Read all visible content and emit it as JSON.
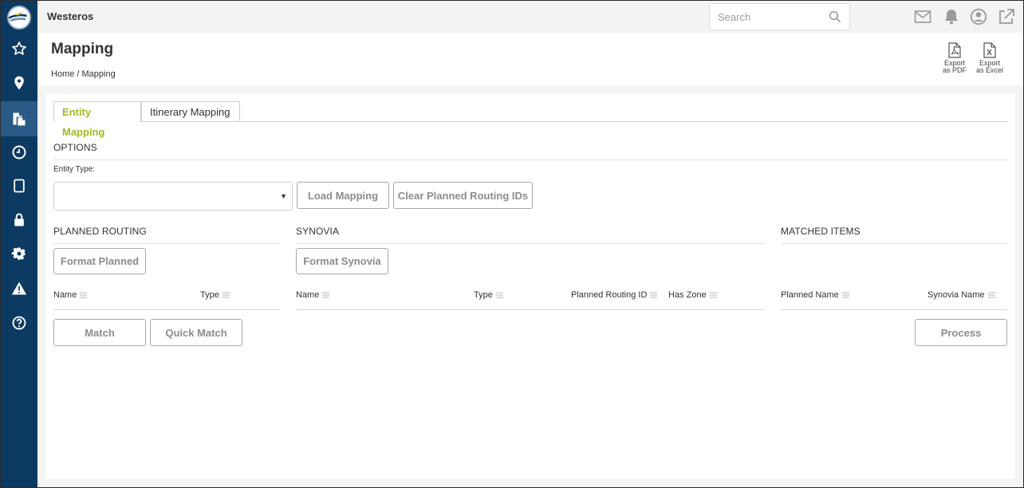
{
  "app": {
    "name": "Westeros"
  },
  "search": {
    "placeholder": "Search"
  },
  "page": {
    "title": "Mapping",
    "breadcrumb": "Home / Mapping"
  },
  "exports": [
    {
      "line1": "Export",
      "line2": "as PDF"
    },
    {
      "line1": "Export",
      "line2": "as Excel"
    }
  ],
  "tabs": [
    {
      "label": "Entity Mapping",
      "active": true
    },
    {
      "label": "Itinerary Mapping",
      "active": false
    }
  ],
  "options": {
    "title": "OPTIONS",
    "entity_type_label": "Entity Type:",
    "entity_type_value": "",
    "load_button": "Load Mapping",
    "clear_button": "Clear Planned Routing IDs"
  },
  "planned": {
    "title": "PLANNED ROUTING",
    "format_button": "Format Planned",
    "columns": [
      "Name",
      "Type"
    ],
    "match_button": "Match",
    "quick_match_button": "Quick Match"
  },
  "synovia": {
    "title": "SYNOVIA",
    "format_button": "Format Synovia",
    "columns": [
      "Name",
      "Type",
      "Planned Routing ID",
      "Has Zone"
    ]
  },
  "matched": {
    "title": "MATCHED ITEMS",
    "columns": [
      "Planned Name",
      "Synovia Name"
    ],
    "process_button": "Process"
  },
  "colors": {
    "sidebar": "#0d3a63",
    "accent": "#a3b826",
    "sidebar_active": "#2a5a86"
  },
  "sidebar_icons": [
    "star-icon",
    "map-pin-icon",
    "documents-icon",
    "clock-icon",
    "tablet-icon",
    "lock-icon",
    "gear-icon",
    "warning-icon",
    "help-icon"
  ]
}
